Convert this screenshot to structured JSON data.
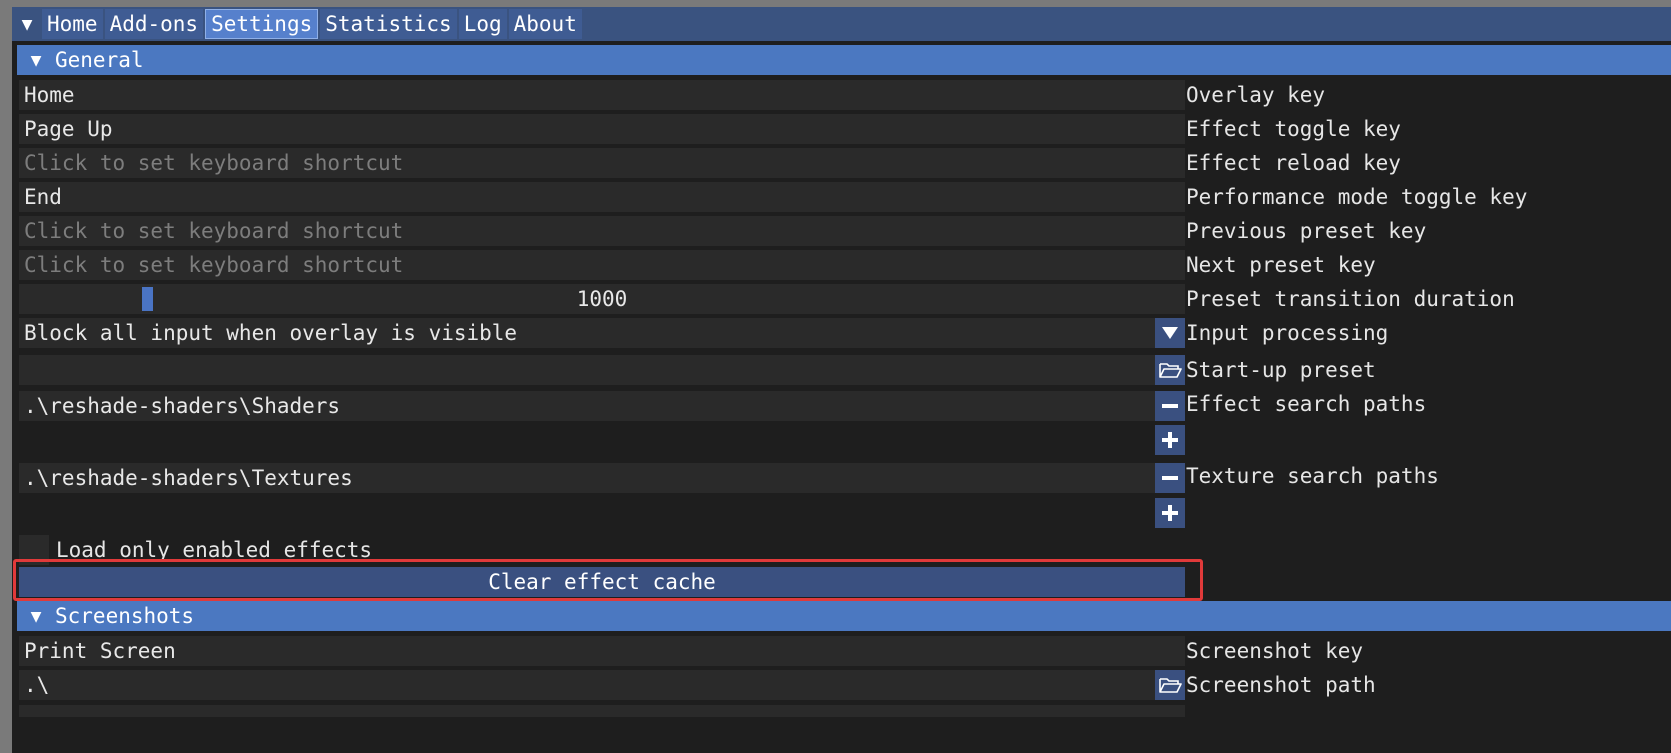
{
  "menu": {
    "tabs": [
      "Home",
      "Add-ons",
      "Settings",
      "Statistics",
      "Log",
      "About"
    ],
    "active_tab": "Settings"
  },
  "general": {
    "header": "General",
    "overlay_key": {
      "value": "Home",
      "label": "Overlay key"
    },
    "effect_toggle_key": {
      "value": "Page Up",
      "label": "Effect toggle key"
    },
    "effect_reload_key": {
      "placeholder": "Click to set keyboard shortcut",
      "label": "Effect reload key"
    },
    "performance_mode_key": {
      "value": "End",
      "label": "Performance mode toggle key"
    },
    "previous_preset_key": {
      "placeholder": "Click to set keyboard shortcut",
      "label": "Previous preset key"
    },
    "next_preset_key": {
      "placeholder": "Click to set keyboard shortcut",
      "label": "Next preset key"
    },
    "preset_transition": {
      "value": "1000",
      "label": "Preset transition duration"
    },
    "input_processing": {
      "value": "Block all input when overlay is visible",
      "label": "Input processing"
    },
    "startup_preset": {
      "value": "",
      "label": "Start-up preset"
    },
    "effect_search_paths": {
      "paths": [
        ".\\reshade-shaders\\Shaders"
      ],
      "label": "Effect search paths"
    },
    "texture_search_paths": {
      "paths": [
        ".\\reshade-shaders\\Textures"
      ],
      "label": "Texture search paths"
    },
    "load_only_enabled": {
      "label": "Load only enabled effects",
      "checked": false
    },
    "clear_cache_button": "Clear effect cache"
  },
  "screenshots": {
    "header": "Screenshots",
    "screenshot_key": {
      "value": "Print Screen",
      "label": "Screenshot key"
    },
    "screenshot_path": {
      "value": ".\\",
      "label": "Screenshot path"
    }
  },
  "colors": {
    "menu_bar": "#3a5380",
    "active_tab": "#5680cc",
    "header": "#4b78c1",
    "button": "#3a5080",
    "field": "#2a2a2a",
    "background": "#1e1e1e",
    "highlight": "#e03a3a"
  },
  "icons": {
    "menu": "triangle-down-icon",
    "collapse": "triangle-down-icon",
    "combo": "triangle-down-icon",
    "browse": "folder-open-icon",
    "remove": "minus-icon",
    "add": "plus-icon"
  }
}
